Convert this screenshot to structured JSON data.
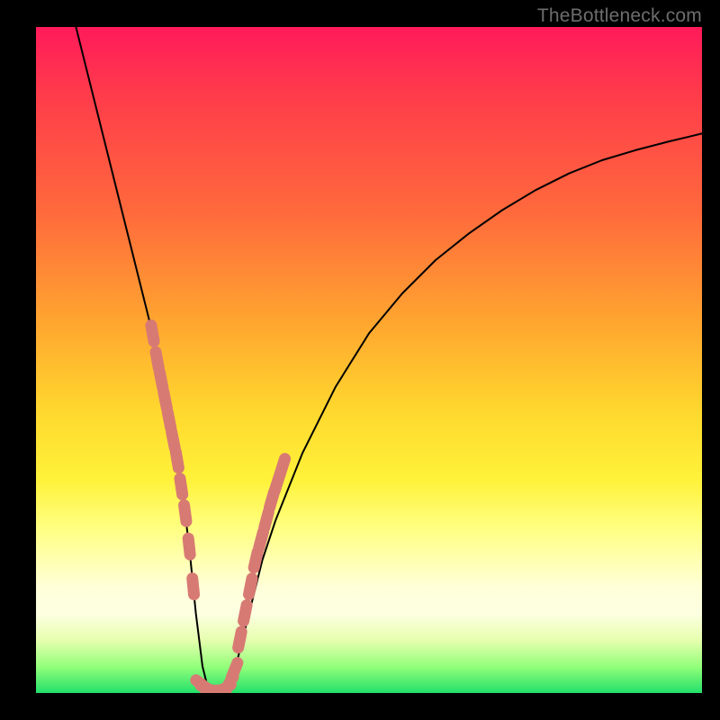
{
  "watermark": "TheBottleneck.com",
  "chart_data": {
    "type": "line",
    "title": "",
    "xlabel": "",
    "ylabel": "",
    "xlim": [
      0,
      100
    ],
    "ylim": [
      0,
      100
    ],
    "grid": false,
    "legend": false,
    "series": [
      {
        "name": "v-curve",
        "color": "#000000",
        "stroke_width": 2,
        "x": [
          6,
          8,
          10,
          12,
          14,
          16,
          18,
          20,
          21,
          22,
          23,
          24,
          25,
          26,
          27,
          28,
          30,
          32,
          34,
          36,
          40,
          45,
          50,
          55,
          60,
          65,
          70,
          75,
          80,
          85,
          90,
          95,
          100
        ],
        "y": [
          100,
          92,
          84,
          76,
          68,
          60,
          52,
          42,
          36,
          30,
          22,
          12,
          4,
          0,
          0,
          0,
          4,
          12,
          20,
          26,
          36,
          46,
          54,
          60,
          65,
          69,
          72.5,
          75.5,
          78,
          80,
          81.5,
          82.8,
          84
        ]
      },
      {
        "name": "left-branch-markers",
        "color": "#d87a74",
        "marker": "bead",
        "x": [
          17.5,
          18.2,
          18.8,
          19.4,
          20.0,
          20.6,
          21.2,
          21.8,
          22.4,
          23.0,
          23.6
        ],
        "y": [
          54,
          50,
          47,
          44,
          41,
          38,
          35,
          31,
          27,
          22,
          16
        ]
      },
      {
        "name": "bottom-markers",
        "color": "#d87a74",
        "marker": "bead",
        "x": [
          25.0,
          25.8,
          26.6,
          27.4,
          28.2,
          29.0,
          29.8
        ],
        "y": [
          1.2,
          0.6,
          0.4,
          0.4,
          0.6,
          1.4,
          3.4
        ]
      },
      {
        "name": "right-branch-markers",
        "color": "#d87a74",
        "marker": "bead",
        "x": [
          30.6,
          31.4,
          32.2,
          33.0,
          33.8,
          34.6,
          35.4,
          36.2,
          37.0
        ],
        "y": [
          8,
          12,
          16,
          20,
          23,
          26,
          29,
          31.5,
          34
        ]
      }
    ],
    "background_gradient": {
      "direction": "top-to-bottom",
      "stops": [
        {
          "pos": 0,
          "color": "#ff1a5a"
        },
        {
          "pos": 10,
          "color": "#ff3b4b"
        },
        {
          "pos": 28,
          "color": "#ff6a3c"
        },
        {
          "pos": 45,
          "color": "#ffa82f"
        },
        {
          "pos": 58,
          "color": "#ffd92e"
        },
        {
          "pos": 68,
          "color": "#fff23a"
        },
        {
          "pos": 75,
          "color": "#ffff7f"
        },
        {
          "pos": 84,
          "color": "#ffffd8"
        },
        {
          "pos": 92,
          "color": "#e7ffb0"
        },
        {
          "pos": 100,
          "color": "#22e06a"
        }
      ]
    }
  }
}
